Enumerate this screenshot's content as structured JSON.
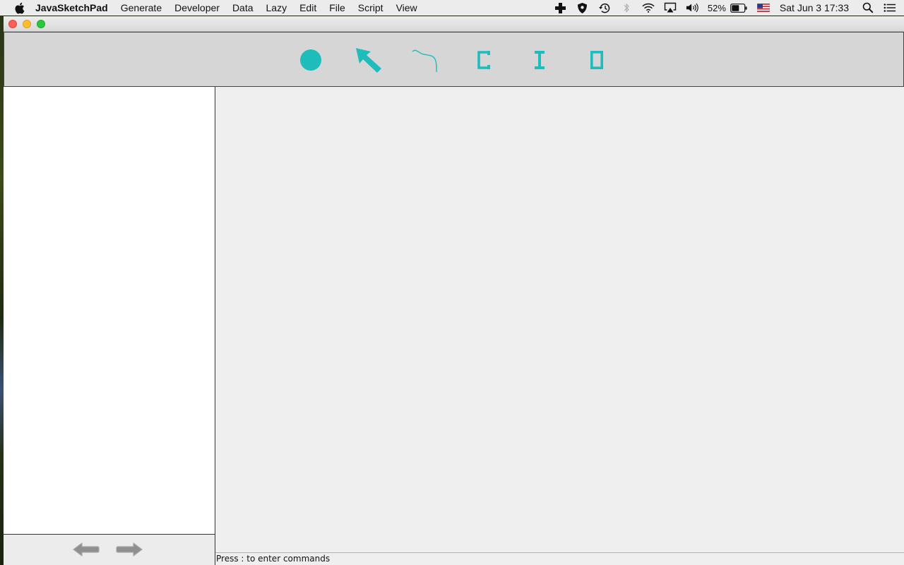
{
  "menubar": {
    "apple_icon": "apple-logo-icon",
    "items": [
      "JavaSketchPad",
      "Generate",
      "Developer",
      "Data",
      "Lazy",
      "Edit",
      "File",
      "Script",
      "View"
    ],
    "status": {
      "battery_percent": "52%",
      "clock": "Sat Jun 3  17:33",
      "icons": [
        "medical-cross-icon",
        "shield-icon",
        "time-machine-icon",
        "bluetooth-icon",
        "wifi-icon",
        "airplay-icon",
        "volume-icon",
        "battery-icon",
        "us-flag-icon",
        "spotlight-search-icon",
        "notification-center-icon"
      ]
    }
  },
  "toolbar": {
    "accent_color": "#1fbcbc",
    "tools": [
      {
        "name": "point-tool",
        "icon": "filled-circle-icon"
      },
      {
        "name": "select-tool",
        "icon": "arrow-cursor-icon"
      },
      {
        "name": "curve-tool",
        "icon": "curve-stroke-icon"
      },
      {
        "name": "c-tool",
        "label": "C"
      },
      {
        "name": "i-tool",
        "label": "I"
      },
      {
        "name": "o-tool",
        "label": "O"
      }
    ]
  },
  "navigation": {
    "back_icon": "back-arrow-icon",
    "forward_icon": "forward-arrow-icon"
  },
  "statusbar": {
    "text": "Press : to enter commands"
  }
}
